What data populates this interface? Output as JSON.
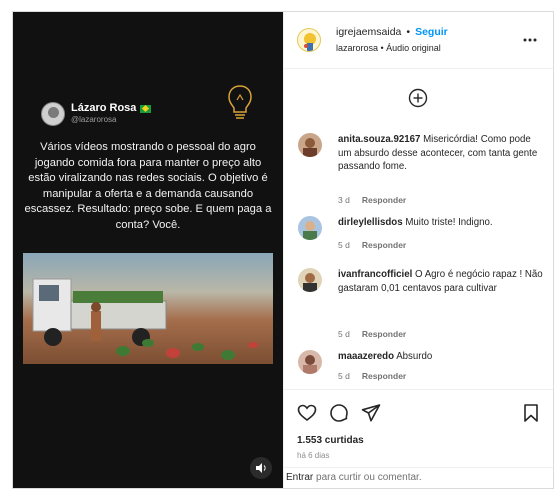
{
  "post": {
    "author_name": "Lázaro Rosa",
    "author_handle": "@lazarorosa",
    "text": "Vários vídeos mostrando o pessoal do agro jogando comida fora para manter o preço alto estão viralizando nas redes sociais. O objetivo é manipular a oferta e a demanda causando escassez. Resultado: preço sobe. E quem paga a conta? Você."
  },
  "header": {
    "username": "igrejaemsaida",
    "separator": "•",
    "follow_label": "Seguir",
    "audio_line": "lazarorosa • Áudio original"
  },
  "comments": [
    {
      "user": "anita.souza.92167",
      "text": "Misericórdia! Como pode um absurdo desse acontecer, com tanta gente passando fome.",
      "age": "3 d",
      "reply": "Responder"
    },
    {
      "user": "dirleylellisdos",
      "text": "Muito triste! Indigno.",
      "age": "5 d",
      "reply": "Responder"
    },
    {
      "user": "ivanfrancofficiel",
      "text": "O Agro é negócio rapaz ! Não gastaram 0,01 centavos para cultivar",
      "age": "5 d",
      "reply": "Responder"
    },
    {
      "user": "maaazeredo",
      "text": "Absurdo",
      "age": "5 d",
      "reply": "Responder"
    }
  ],
  "footer": {
    "likes": "1.553 curtidas",
    "ago": "há 6 dias",
    "login_enter": "Entrar",
    "login_rest": " para curtir ou comentar."
  },
  "icons": {
    "more": "more-options-icon",
    "add_comment": "plus-circle-icon",
    "like": "heart-icon",
    "comment": "comment-icon",
    "share": "send-icon",
    "save": "bookmark-icon",
    "volume": "volume-icon",
    "idea": "lightbulb-icon"
  },
  "colors": {
    "accent": "#0095f6",
    "text": "#262626",
    "muted": "#737373"
  }
}
